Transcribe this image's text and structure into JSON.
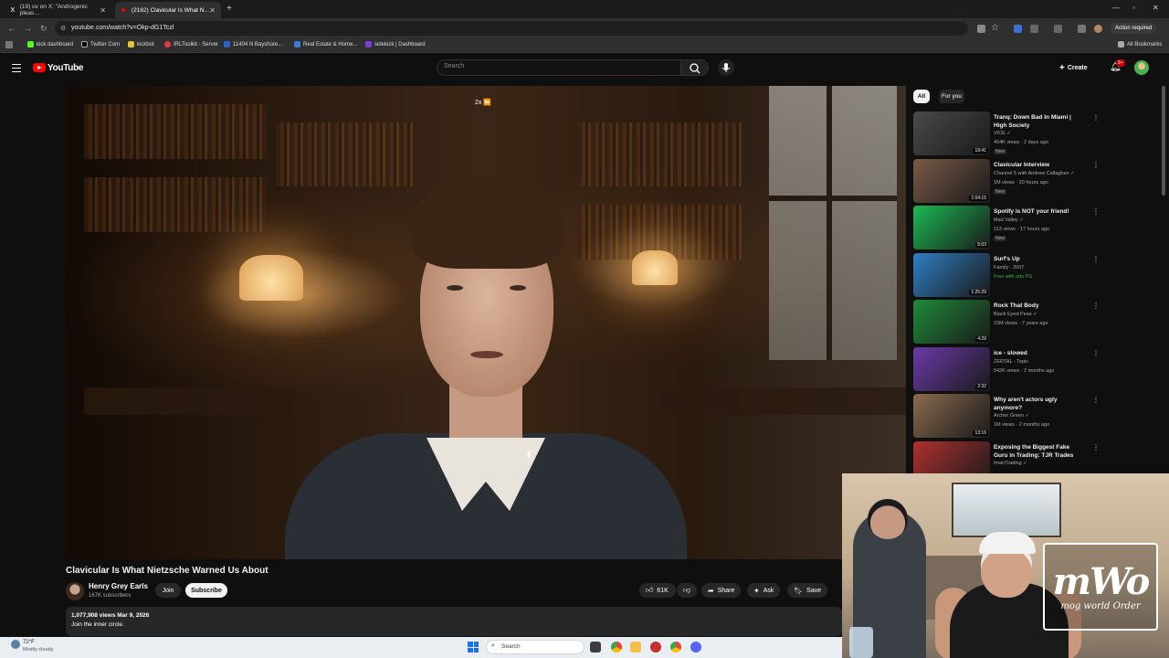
{
  "browser": {
    "tabs": [
      {
        "label": "(19) υv on X: \"Androgenic pleas…",
        "icon": "x-logo-icon"
      },
      {
        "label": "(2162) Clavicular Is What N…",
        "icon": "youtube-icon"
      }
    ],
    "url": "youtube.com/watch?v=Okp-dG1Tczl",
    "action_required": "Action required",
    "all_bookmarks": "All Bookmarks",
    "bookmarks": [
      "kick dashboard",
      "Twitter Com",
      "kickbot",
      "IRLToolkit - Server",
      "11404 N Bayshore...",
      "Real Estate & Home...",
      "sidekick | Dashboard"
    ]
  },
  "youtube": {
    "logo": "YouTube",
    "search_placeholder": "Search",
    "create_label": "Create",
    "notification_count": "9+"
  },
  "player": {
    "speed_label": "2x ⏩"
  },
  "video": {
    "title": "Clavicular Is What Nietzsche Warned Us About",
    "channel": "Henry Grey Earls",
    "subscribers": "167K subscribers",
    "join": "Join",
    "subscribe": "Subscribe",
    "likes": "61K",
    "share": "Share",
    "ask": "Ask",
    "save": "Save",
    "views_date": "1,077,908 views  Mar 9, 2026",
    "description": "Join the inner circle."
  },
  "sidebar": {
    "chips": [
      "All",
      "For you"
    ],
    "items": [
      {
        "title": "Tranq: Down Bad In Miami | High Society",
        "channel": "VICE ✓",
        "meta": "404K views · 2 days ago",
        "badge": "New",
        "duration": "19:41",
        "thumb": "#4a4a4a"
      },
      {
        "title": "Clavicular Interview",
        "channel": "Channel 5 with Andrew Callaghan ✓",
        "meta": "1M views · 20 hours ago",
        "badge": "New",
        "duration": "1:04:15",
        "thumb": "#7a5a48"
      },
      {
        "title": "Spotify is NOT your friend!",
        "channel": "Mad Valley ✓",
        "meta": "113 views · 17 hours ago",
        "badge": "New",
        "duration": "5:03",
        "thumb": "#1db954"
      },
      {
        "title": "Surf's Up",
        "channel": "Family · 2007",
        "meta": "Free with ads  PG",
        "badge": "",
        "duration": "1:25:29",
        "thumb": "#2f7fc4"
      },
      {
        "title": "Rock That Body",
        "channel": "Black Eyed Peas ✓",
        "meta": "23M views · 7 years ago",
        "badge": "",
        "duration": "4:29",
        "thumb": "#1f8a3a"
      },
      {
        "title": "ice - slowed",
        "channel": "ZERTAL - Topic",
        "meta": "542K views · 2 months ago",
        "badge": "",
        "duration": "2:32",
        "thumb": "#6a3aa8"
      },
      {
        "title": "Why aren't actors ugly anymore?",
        "channel": "Archer Green ✓",
        "meta": "1M views · 2 months ago",
        "badge": "",
        "duration": "13:16",
        "thumb": "#8a6a50"
      },
      {
        "title": "Exposing the Biggest Fake Guru in Trading: TJR Trades",
        "channel": "ImanTrading ✓",
        "meta": "",
        "badge": "",
        "duration": "",
        "thumb": "#b03030"
      }
    ]
  },
  "webcam": {
    "overlay_big": "mWo",
    "overlay_sub": "mog world Order"
  },
  "taskbar": {
    "temp": "72°F",
    "weather": "Mostly cloudy",
    "search": "Search"
  }
}
